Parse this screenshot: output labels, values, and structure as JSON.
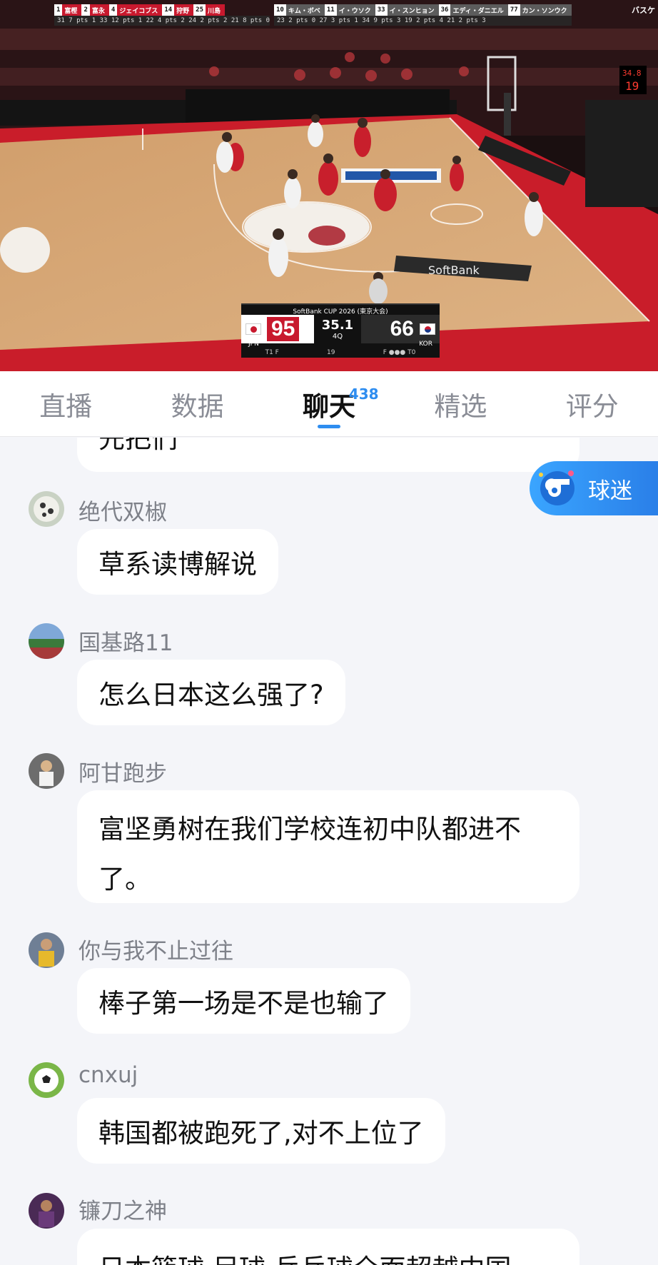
{
  "video": {
    "scoreboard_top": {
      "jpn_players": [
        {
          "num": "1",
          "name": "富樫"
        },
        {
          "num": "2",
          "name": "富永"
        },
        {
          "num": "4",
          "name": "ジェイコブス"
        },
        {
          "num": "14",
          "name": "狩野"
        },
        {
          "num": "25",
          "name": "川島"
        }
      ],
      "jpn_stats": "31  7  pts 1  33 12 pts 1  22 4 pts 2  24 2 pts 2  21 8 pts 0",
      "kor_players": [
        {
          "num": "10",
          "name": "キム・ボベ"
        },
        {
          "num": "11",
          "name": "イ・ウソク"
        },
        {
          "num": "33",
          "name": "イ・スンヒョン"
        },
        {
          "num": "36",
          "name": "エディ・ダニエル"
        },
        {
          "num": "77",
          "name": "カン・ソンウク"
        }
      ],
      "kor_stats": "23  2 pts 0  27  3 pts 1  34  9 pts 3  19  2 pts 4  21  2 pts 3",
      "brand": "バスケ"
    },
    "scorebug": {
      "cup": "SoftBank CUP 2026 (東京大会)",
      "home_code": "JPN",
      "home_score": "95",
      "clock": "35.1",
      "quarter": "4Q",
      "away_score": "66",
      "away_code": "KOR",
      "home_to": "T1  F",
      "shot_clock": "19",
      "away_to": "F ●●●  T0"
    },
    "shot_clock_display": "34.8\n19",
    "court_banners": [
      "SoftBank",
      "SoftBank"
    ]
  },
  "tabs": [
    {
      "label": "直播"
    },
    {
      "label": "数据"
    },
    {
      "label": "聊天",
      "badge": "438",
      "active": true
    },
    {
      "label": "精选"
    },
    {
      "label": "评分"
    }
  ],
  "fan_button": {
    "label": "球迷"
  },
  "messages": [
    {
      "user": "",
      "text": "先把们"
    },
    {
      "user": "绝代双椒",
      "text": "草系读博解说",
      "avatar": "soccer-ball"
    },
    {
      "user": "国基路11",
      "text": "怎么日本这么强了?",
      "avatar": "stadium"
    },
    {
      "user": "阿甘跑步",
      "text": "富坚勇树在我们学校连初中队都进不了。",
      "avatar": "player"
    },
    {
      "user": "你与我不止过往",
      "text": "棒子第一场是不是也输了",
      "avatar": "player-yellow"
    },
    {
      "user": "cnxuj",
      "text": "韩国都被跑死了,对不上位了",
      "avatar": "football"
    },
    {
      "user": "镰刀之神",
      "text": "日本篮球 足球 乒乓球全面超越中国",
      "avatar": "player-purple"
    }
  ]
}
